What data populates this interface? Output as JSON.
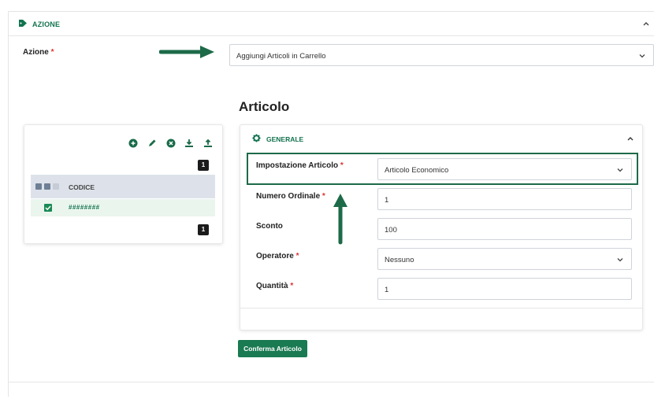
{
  "section": {
    "title": "AZIONE"
  },
  "azione": {
    "label": "Azione",
    "required": "*",
    "value": "Aggiungi Articoli in Carrello"
  },
  "articolo": {
    "heading": "Articolo"
  },
  "left_panel": {
    "toolbar": [
      "add-icon",
      "edit-icon",
      "remove-icon",
      "download-icon",
      "upload-icon"
    ],
    "page_top": "1",
    "column_header": "CODICE",
    "row_code": "########",
    "page_bottom": "1"
  },
  "card": {
    "title": "GENERALE",
    "fields": [
      {
        "label": "Impostazione Articolo",
        "required": "*",
        "value": "Articolo Economico",
        "type": "select"
      },
      {
        "label": "Numero Ordinale",
        "required": "*",
        "value": "1",
        "type": "input"
      },
      {
        "label": "Sconto",
        "required": "",
        "value": "100",
        "type": "input"
      },
      {
        "label": "Operatore",
        "required": "*",
        "value": "Nessuno",
        "type": "select"
      },
      {
        "label": "Quantità",
        "required": "*",
        "value": "1",
        "type": "input"
      }
    ]
  },
  "confirm_button": "Conferma Articolo",
  "colors": {
    "accent": "#1a7a52",
    "highlight_border": "#1d6a48",
    "required": "#e03131"
  }
}
